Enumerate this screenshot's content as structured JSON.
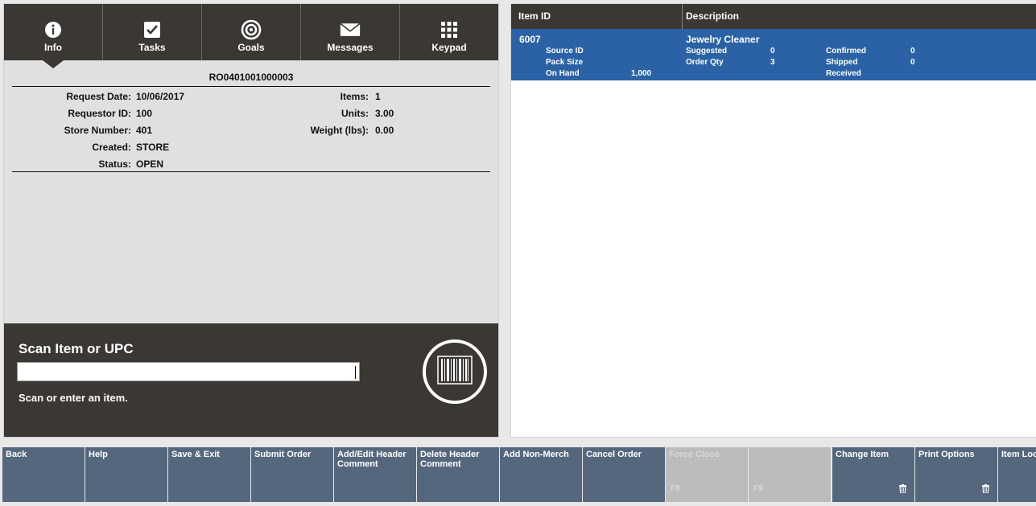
{
  "tabs": [
    {
      "label": "Info",
      "icon": "info-icon"
    },
    {
      "label": "Tasks",
      "icon": "checkbox-icon"
    },
    {
      "label": "Goals",
      "icon": "target-icon"
    },
    {
      "label": "Messages",
      "icon": "envelope-icon"
    },
    {
      "label": "Keypad",
      "icon": "keypad-icon"
    }
  ],
  "order": {
    "number": "RO0401001000003",
    "fields_left": [
      {
        "label": "Request Date:",
        "value": "10/06/2017"
      },
      {
        "label": "Requestor ID:",
        "value": "100"
      },
      {
        "label": "Store Number:",
        "value": "401"
      },
      {
        "label": "Created:",
        "value": "STORE"
      },
      {
        "label": "Status:",
        "value": "OPEN"
      }
    ],
    "fields_right": [
      {
        "label": "Items:",
        "value": "1"
      },
      {
        "label": "Units:",
        "value": "3.00"
      },
      {
        "label": "Weight (lbs):",
        "value": "0.00"
      }
    ]
  },
  "scan": {
    "title": "Scan Item or UPC",
    "value": "",
    "hint": "Scan or enter an item."
  },
  "grid": {
    "columns": [
      "Item ID",
      "Description"
    ],
    "items": [
      {
        "item_id": "6007",
        "description": "Jewelry Cleaner",
        "source_id_label": "Source ID",
        "pack_size_label": "Pack Size",
        "on_hand_label": "On Hand",
        "on_hand": "1,000",
        "suggested_label": "Suggested",
        "suggested": "0",
        "order_qty_label": "Order Qty",
        "order_qty": "3",
        "confirmed_label": "Confirmed",
        "confirmed": "0",
        "shipped_label": "Shipped",
        "shipped": "0",
        "received_label": "Received"
      }
    ]
  },
  "toolbar": [
    {
      "label": "Back",
      "enabled": true
    },
    {
      "label": "Help",
      "enabled": true
    },
    {
      "label": "Save & Exit",
      "enabled": true
    },
    {
      "label": "Submit Order",
      "enabled": true
    },
    {
      "label": "Add/Edit Header Comment",
      "enabled": true
    },
    {
      "label": "Delete Header Comment",
      "enabled": true
    },
    {
      "label": "Add Non-Merch",
      "enabled": true
    },
    {
      "label": "Cancel Order",
      "enabled": true
    },
    {
      "label": "Force Close",
      "key": "F8",
      "enabled": false
    },
    {
      "label": "",
      "key": "F9",
      "enabled": false
    },
    {
      "label": "Change Item",
      "enabled": true,
      "icon": "trash-icon"
    },
    {
      "label": "Print Options",
      "enabled": true,
      "icon": "trash-icon"
    },
    {
      "label": "Item Loo",
      "enabled": true
    }
  ],
  "colors": {
    "dark_panel": "#3b3834",
    "selected_row": "#2a62a5",
    "toolbar_button": "#55677d",
    "toolbar_disabled": "#bcbcbc"
  }
}
